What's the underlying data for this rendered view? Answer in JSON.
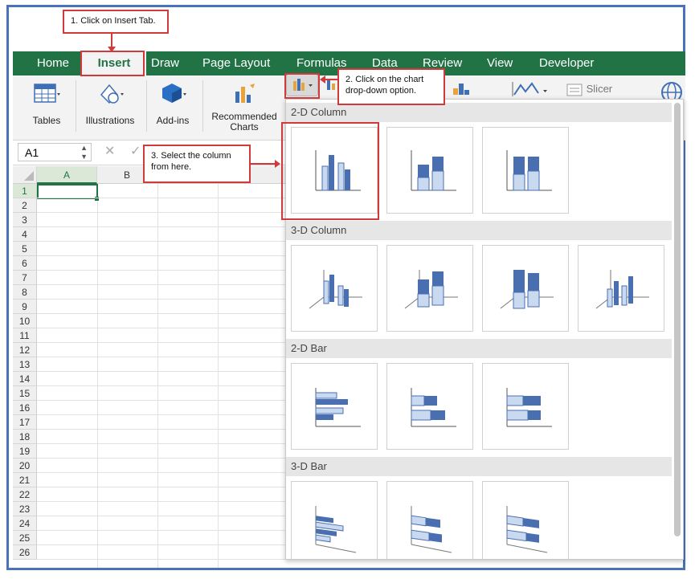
{
  "callouts": {
    "step1": "1. Click on Insert Tab.",
    "step2": "2. Click on the chart drop-down option.",
    "step3": "3. Select the column from here."
  },
  "tabs": [
    "Home",
    "Insert",
    "Draw",
    "Page Layout",
    "Formulas",
    "Data",
    "Review",
    "View",
    "Developer"
  ],
  "active_tab": "Insert",
  "ribbon": {
    "tables": "Tables",
    "illustrations": "Illustrations",
    "addins": "Add-ins",
    "recommended_charts": "Recommended Charts",
    "slicer": "Slicer"
  },
  "formula_bar": {
    "name_box": "A1"
  },
  "grid": {
    "columns": [
      "A",
      "B"
    ],
    "rows": [
      "1",
      "2",
      "3",
      "4",
      "5",
      "6",
      "7",
      "8",
      "9",
      "10",
      "11",
      "12",
      "13",
      "14",
      "15",
      "16",
      "17",
      "18",
      "19",
      "20",
      "21",
      "22",
      "23",
      "24",
      "25",
      "26"
    ],
    "selected_cell": "A1"
  },
  "chart_menu": {
    "sections": [
      "2-D Column",
      "3-D Column",
      "2-D Bar",
      "3-D Bar"
    ]
  },
  "colors": {
    "excel_green": "#217346",
    "callout_red": "#d13a3a",
    "frame_blue": "#4a72b8",
    "chart_blue": "#4a6fb0",
    "chart_light": "#c9d9f0"
  }
}
